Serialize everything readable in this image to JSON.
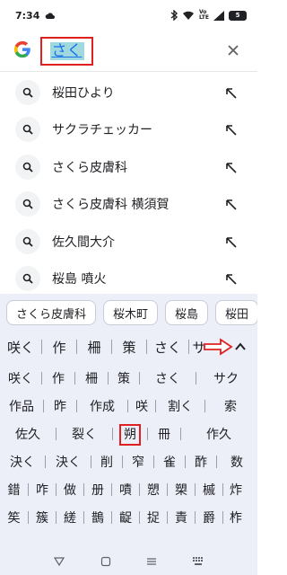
{
  "status": {
    "time": "7:34",
    "volte_top": "Vo",
    "volte_bottom": "LTE",
    "battery": "5"
  },
  "search": {
    "query": "さく"
  },
  "suggestions": [
    {
      "text": "桜田ひより"
    },
    {
      "text": "サクラチェッカー"
    },
    {
      "text": "さくら皮膚科"
    },
    {
      "text": "さくら皮膚科 横須賀"
    },
    {
      "text": "佐久間大介"
    },
    {
      "text": "桜島 噴火"
    }
  ],
  "chips": [
    "さくら皮膚科",
    "桜木町",
    "桜島",
    "桜田"
  ],
  "candidates": [
    "咲く",
    "作",
    "柵",
    "策",
    "さく",
    "サ"
  ],
  "kanji_rows": [
    [
      "咲く",
      "作",
      "柵",
      "策",
      "さく",
      "サク"
    ],
    [
      "作品",
      "昨",
      "作成",
      "咲",
      "割く",
      "索"
    ],
    [
      "佐久",
      "裂く",
      "朔",
      "冊",
      "作久"
    ],
    [
      "決く",
      "決く",
      "削",
      "窄",
      "雀",
      "酢",
      "数"
    ],
    [
      "錯",
      "咋",
      "做",
      "册",
      "嘖",
      "愬",
      "槊",
      "槭",
      "炸"
    ],
    [
      "笶",
      "簇",
      "縒",
      "鵲",
      "齪",
      "捉",
      "責",
      "爵",
      "柞"
    ]
  ],
  "colors": {
    "highlight": "#e02020",
    "accent": "#1a73e8",
    "keyboard_bg": "#eceef8"
  }
}
